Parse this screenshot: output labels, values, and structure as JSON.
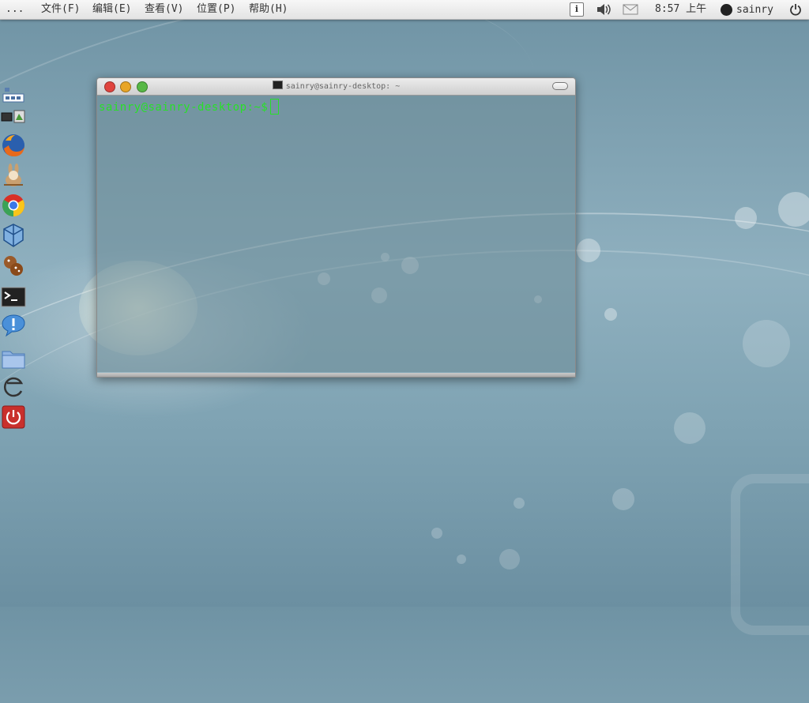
{
  "top_panel": {
    "applications_label": "...",
    "menus": [
      {
        "label": "文件(F)"
      },
      {
        "label": "编辑(E)"
      },
      {
        "label": "查看(V)"
      },
      {
        "label": "位置(P)"
      },
      {
        "label": "帮助(H)"
      }
    ],
    "clock": "8:57 上午",
    "username": "sainry",
    "info_symbol": "i"
  },
  "launcher": {
    "items": [
      {
        "name": "network-applet-icon"
      },
      {
        "name": "display-settings-icon"
      },
      {
        "name": "firefox-icon"
      },
      {
        "name": "rabbitvcs-icon"
      },
      {
        "name": "chrome-icon"
      },
      {
        "name": "virtualbox-icon"
      },
      {
        "name": "cookies-icon"
      },
      {
        "name": "terminal-icon"
      },
      {
        "name": "pidgin-icon"
      },
      {
        "name": "folder-icon"
      },
      {
        "name": "browser-e-icon"
      },
      {
        "name": "shutdown-icon"
      }
    ]
  },
  "terminal": {
    "title": "sainry@sainry-desktop: ~",
    "prompt": "sainry@sainry-desktop:~$",
    "prompt_color": "#28e028"
  },
  "colors": {
    "close": "#e0443e",
    "minimize": "#e8a526",
    "maximize": "#57b845"
  }
}
